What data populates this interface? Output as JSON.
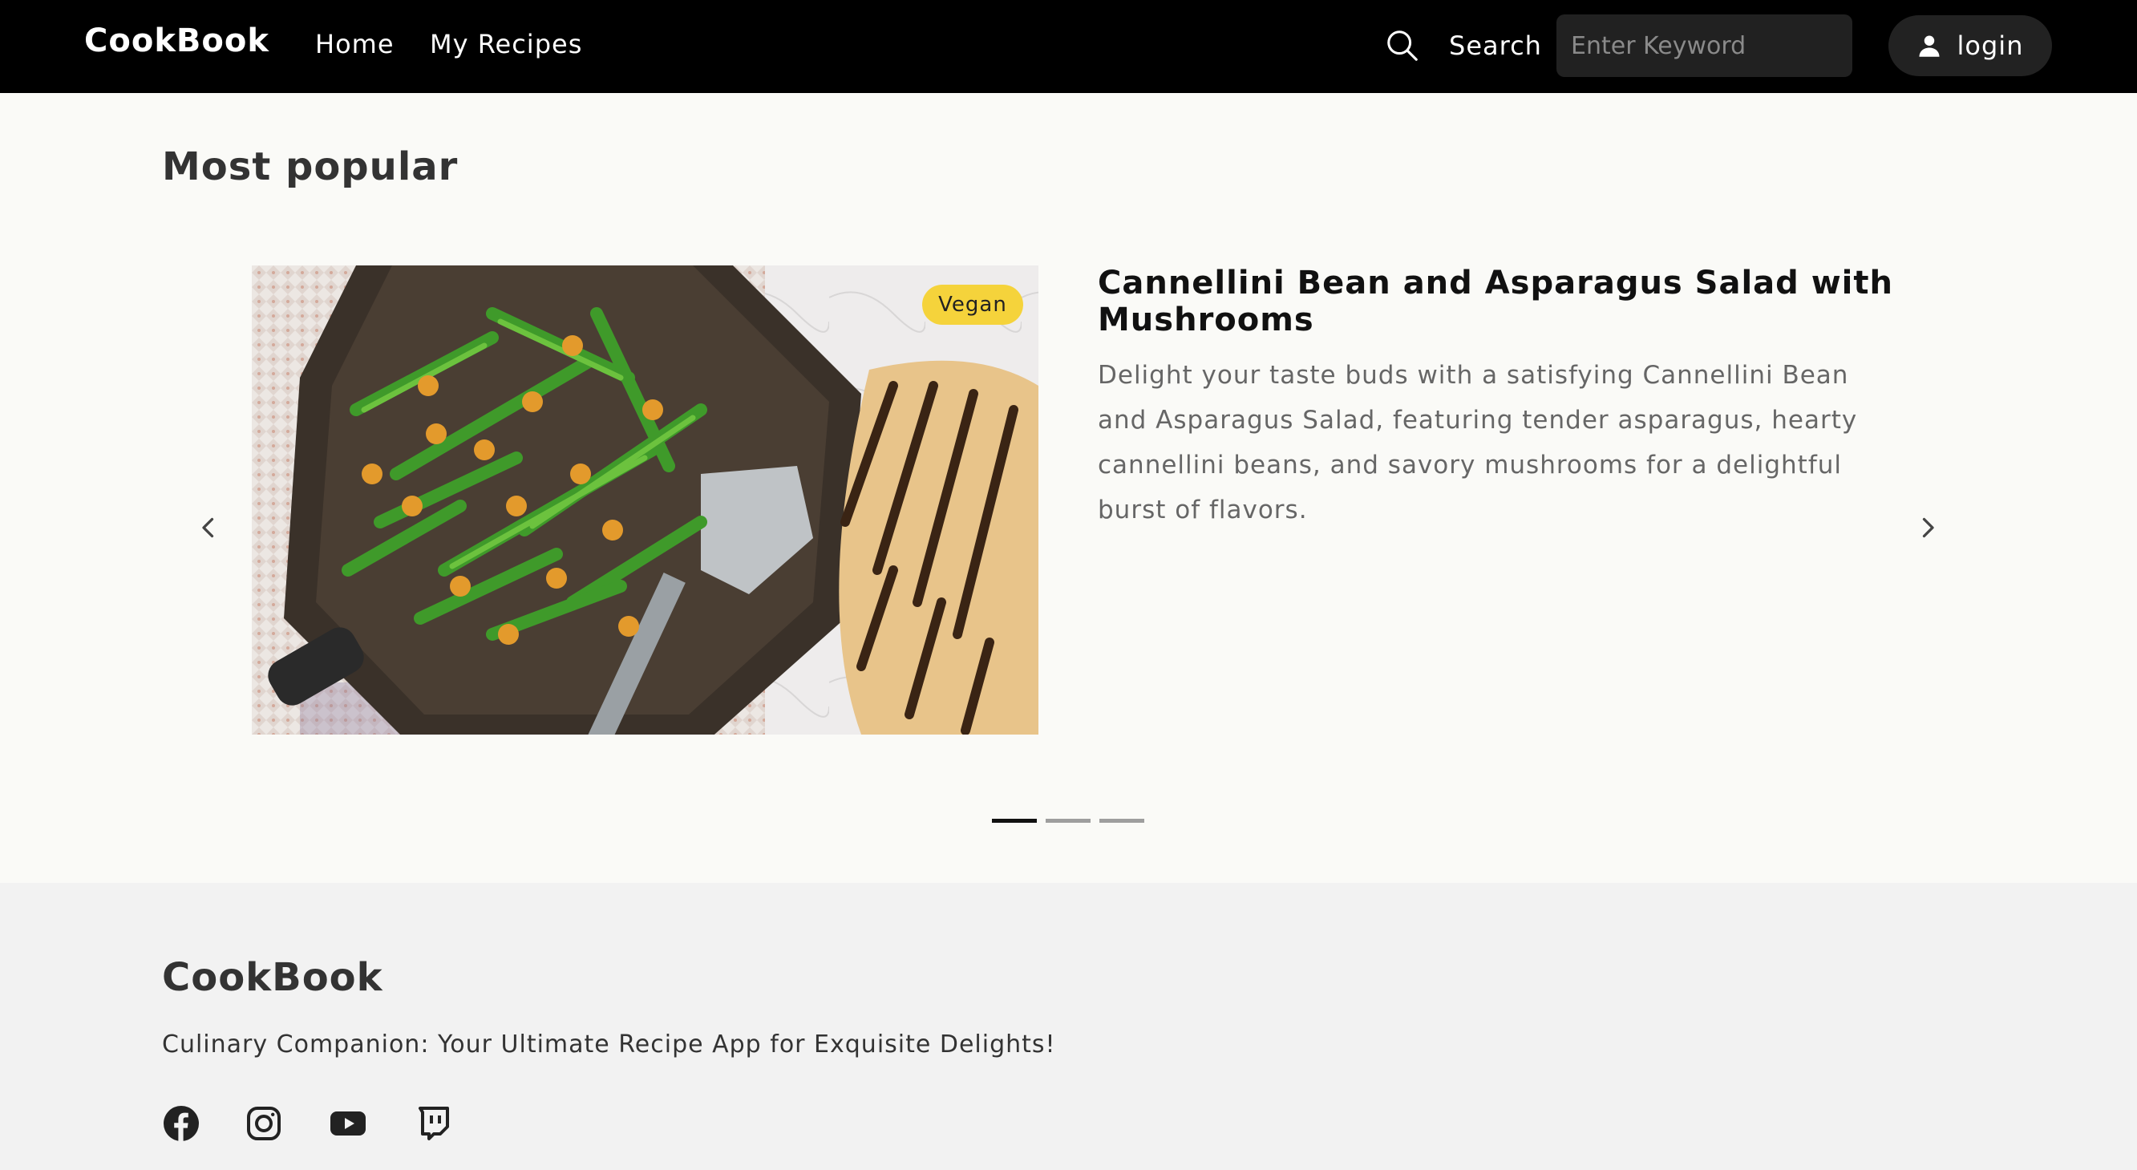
{
  "navbar": {
    "brand": "CookBook",
    "links": [
      "Home",
      "My Recipes"
    ],
    "search_label": "Search",
    "search_placeholder": "Enter Keyword",
    "login_label": "login"
  },
  "main": {
    "section_title": "Most popular",
    "slide": {
      "badge": "Vegan",
      "title": "Cannellini Bean and Asparagus Salad with Mushrooms",
      "description": "Delight your taste buds with a satisfying Cannellini Bean and Asparagus Salad, featuring tender asparagus, hearty cannellini beans, and savory mushrooms for a delightful burst of flavors."
    },
    "carousel": {
      "total_slides": 3,
      "active_index": 0
    }
  },
  "footer": {
    "brand": "CookBook",
    "tagline": "Culinary Companion: Your Ultimate Recipe App for Exquisite Delights!",
    "social_icons": [
      "facebook-icon",
      "instagram-icon",
      "youtube-icon",
      "twitch-icon"
    ]
  },
  "colors": {
    "navbar_bg": "#000000",
    "badge": "#f5d33b",
    "page_bg": "#fafaf7",
    "footer_bg": "#f2f2f2"
  }
}
